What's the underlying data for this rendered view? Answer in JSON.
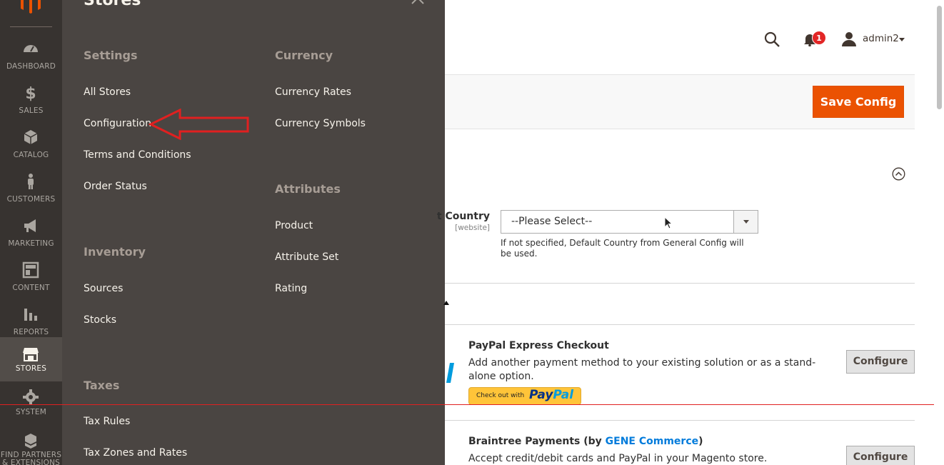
{
  "sidebar": {
    "logo_icon": "magento-logo-icon",
    "items": [
      {
        "label": "DASHBOARD",
        "icon": "dashboard-icon"
      },
      {
        "label": "SALES",
        "icon": "dollar-icon"
      },
      {
        "label": "CATALOG",
        "icon": "cube-icon"
      },
      {
        "label": "CUSTOMERS",
        "icon": "person-icon"
      },
      {
        "label": "MARKETING",
        "icon": "megaphone-icon"
      },
      {
        "label": "CONTENT",
        "icon": "layout-icon"
      },
      {
        "label": "REPORTS",
        "icon": "bar-chart-icon"
      },
      {
        "label": "STORES",
        "icon": "storefront-icon",
        "active": true
      },
      {
        "label": "SYSTEM",
        "icon": "gear-icon"
      },
      {
        "label": "FIND PARTNERS & EXTENSIONS",
        "icon": "boxes-icon"
      }
    ]
  },
  "stores_panel": {
    "title": "Stores",
    "settings": {
      "title": "Settings",
      "links": [
        "All Stores",
        "Configuration",
        "Terms and Conditions",
        "Order Status"
      ]
    },
    "inventory": {
      "title": "Inventory",
      "links": [
        "Sources",
        "Stocks"
      ]
    },
    "taxes": {
      "title": "Taxes",
      "links": [
        "Tax Rules",
        "Tax Zones and Rates"
      ]
    },
    "currency": {
      "title": "Currency",
      "links": [
        "Currency Rates",
        "Currency Symbols"
      ]
    },
    "attributes": {
      "title": "Attributes",
      "links": [
        "Product",
        "Attribute Set",
        "Rating"
      ]
    }
  },
  "header": {
    "notification_count": "1",
    "username": "admin2"
  },
  "actions": {
    "save_label": "Save Config"
  },
  "config": {
    "country_label": "t Country",
    "country_scope": "[website]",
    "country_value": "--Please Select--",
    "country_note": "If not specified, Default Country from General Config will be used."
  },
  "payments": {
    "express": {
      "title": "PayPal Express Checkout",
      "desc": "Add another payment method to your existing solution or as a stand-alone option.",
      "button_pre": "Check out with",
      "button_brand_a": "Pay",
      "button_brand_b": "Pal",
      "configure": "Configure"
    },
    "braintree": {
      "title_pre": "Braintree Payments (by ",
      "title_link": "GENE Commerce",
      "title_post": ")",
      "desc": "Accept credit/debit cards and PayPal in your Magento store.",
      "configure": "Configure"
    }
  },
  "colors": {
    "sidebar_bg": "#373330",
    "panel_bg": "#4a4542",
    "accent": "#eb5202",
    "annotation": "#e02020"
  }
}
